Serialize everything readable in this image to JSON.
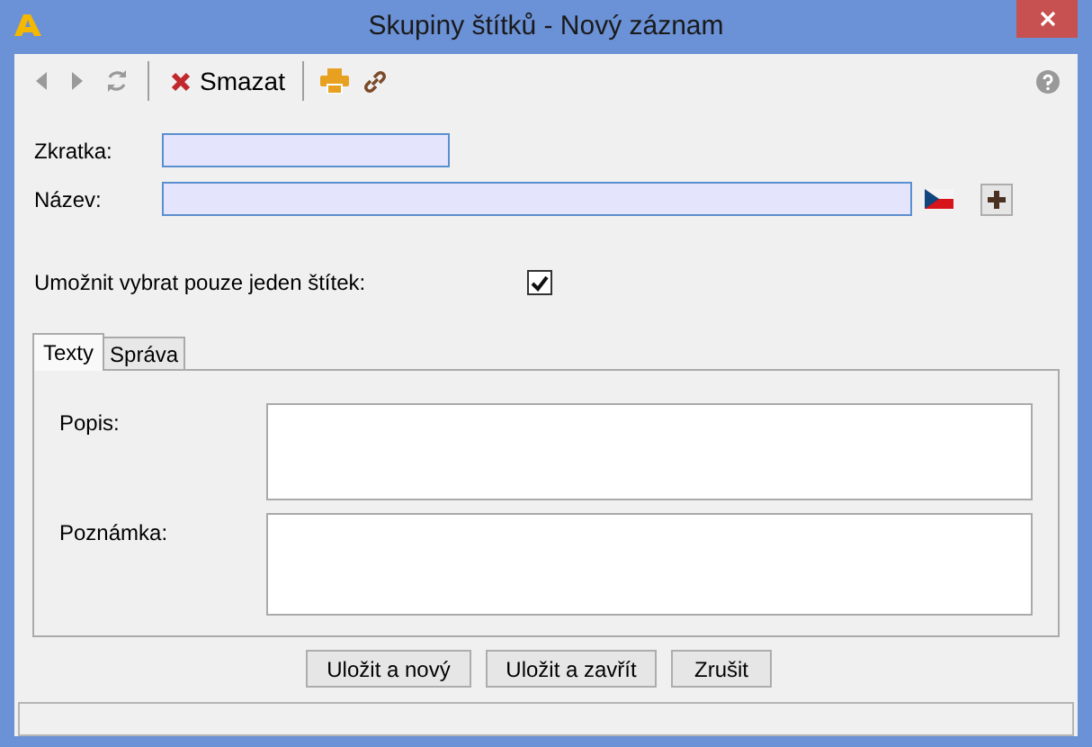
{
  "window": {
    "title": "Skupiny štítků - Nový záznam"
  },
  "toolbar": {
    "delete_label": "Smazat"
  },
  "fields": [
    {
      "kind": "short",
      "label": "Zkratka:"
    },
    {
      "kind": "long",
      "label": "Název:"
    }
  ],
  "single_select": {
    "label": "Umožnit vybrat pouze jeden štítek:",
    "checked": true
  },
  "tabs": [
    {
      "label": "Texty",
      "selected": true
    },
    {
      "label": "Správa",
      "selected": false
    }
  ],
  "text_areas": [
    {
      "label": "Popis:"
    },
    {
      "label": "Poznámka:"
    }
  ],
  "buttons": [
    "Uložit a nový",
    "Uložit a zavřít",
    "Zrušit"
  ]
}
